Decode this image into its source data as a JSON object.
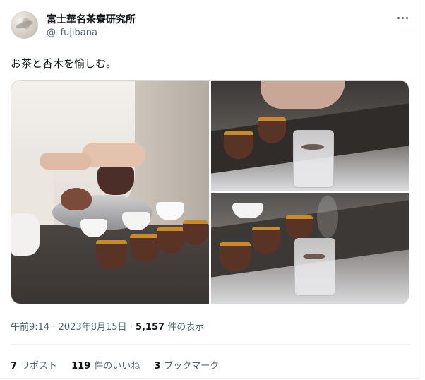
{
  "author": {
    "name": "富士華名茶寮研究所",
    "handle": "@_fujibana"
  },
  "tweet": {
    "text": "お茶と香木を愉しむ。"
  },
  "media": {
    "images": [
      {
        "alt": "tea-ceremony-hands-teapot-cups"
      },
      {
        "alt": "hand-placing-incense-in-glass"
      },
      {
        "alt": "smoking-incense-glass-with-cups"
      }
    ]
  },
  "meta": {
    "time": "午前9:14",
    "sep1": "·",
    "date": "2023年8月15日",
    "sep2": "·",
    "views_count": "5,157",
    "views_label": "件の表示"
  },
  "stats": {
    "reposts_count": "7",
    "reposts_label": "リポスト",
    "likes_count": "119",
    "likes_label": "件のいいね",
    "bookmarks_count": "3",
    "bookmarks_label": "ブックマーク"
  },
  "icons": {
    "more": "more-horizontal-icon"
  }
}
